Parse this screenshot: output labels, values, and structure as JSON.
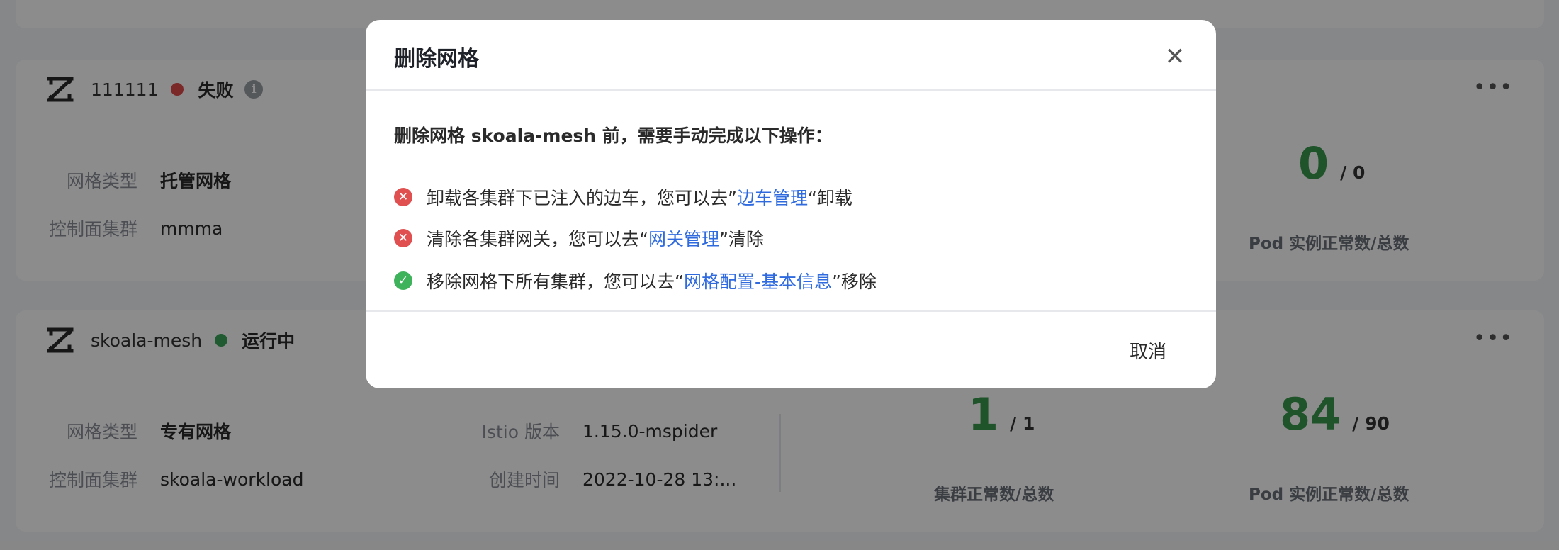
{
  "cards": [
    {
      "name": "111111",
      "status": "失败",
      "status_color": "#e04a4a",
      "mesh_type_label": "网格类型",
      "mesh_type": "托管网格",
      "control_cluster_label": "控制面集群",
      "control_cluster": "mmma",
      "pod_ok": "0",
      "pod_total": "/ 0",
      "pod_label": "Pod 实例正常数/总数"
    },
    {
      "name": "skoala-mesh",
      "status": "运行中",
      "status_color": "#3aa55a",
      "mesh_type_label": "网格类型",
      "mesh_type": "专有网格",
      "control_cluster_label": "控制面集群",
      "control_cluster": "skoala-workload",
      "istio_label": "Istio 版本",
      "istio_version": "1.15.0-mspider",
      "created_label": "创建时间",
      "created_time": "2022-10-28 13:...",
      "cluster_ok": "1",
      "cluster_total": "/ 1",
      "cluster_label": "集群正常数/总数",
      "pod_ok": "84",
      "pod_total": "/ 90",
      "pod_label": "Pod 实例正常数/总数"
    }
  ],
  "modal": {
    "title": "删除网格",
    "intro": "删除网格 skoala-mesh 前，需要手动完成以下操作：",
    "steps": [
      {
        "status": "error",
        "pre": "卸载各集群下已注入的边车，您可以去”",
        "link": "边车管理",
        "post": "“卸载"
      },
      {
        "status": "error",
        "pre": "清除各集群网关，您可以去“",
        "link": "网关管理",
        "post": "”清除"
      },
      {
        "status": "success",
        "pre": "移除网格下所有集群，您可以去“",
        "link": "网格配置-基本信息",
        "post": "”移除"
      }
    ],
    "cancel_label": "取消"
  },
  "icons": {
    "mesh": "mesh-icon",
    "close": "close-icon",
    "more": "more-icon",
    "info": "info-icon",
    "error": "error-circle-icon",
    "success": "check-circle-icon"
  },
  "colors": {
    "link": "#2f6bde",
    "success": "#3a9a4d",
    "error": "#e05050"
  }
}
